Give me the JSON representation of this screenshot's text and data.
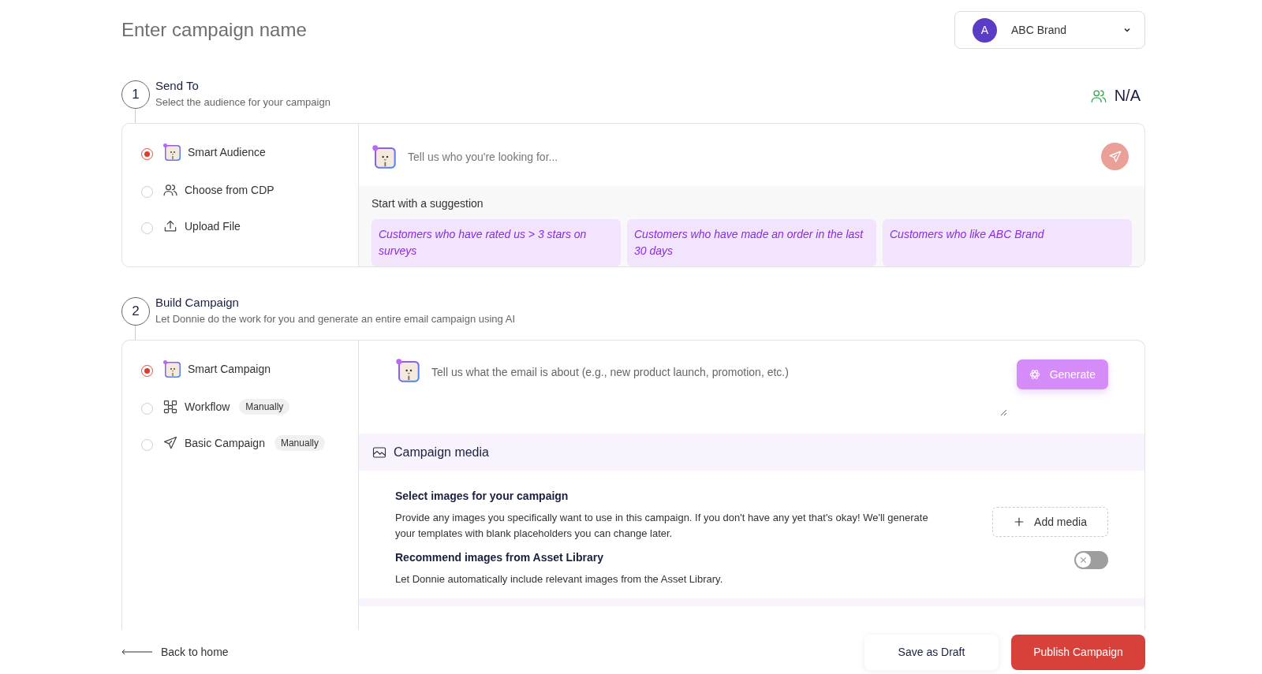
{
  "campaign_name": {
    "placeholder": "Enter campaign name"
  },
  "brand_select": {
    "avatar": "A",
    "label": "ABC Brand"
  },
  "send_to": {
    "number": "1",
    "title": "Send To",
    "subtitle": "Select the audience for your campaign",
    "audience_count": "N/A",
    "options": [
      {
        "label": "Smart Audience",
        "kind": "mascot",
        "selected": true
      },
      {
        "label": "Choose from CDP",
        "kind": "users",
        "selected": false
      },
      {
        "label": "Upload File",
        "kind": "upload",
        "selected": false
      }
    ],
    "prompt": {
      "placeholder": "Tell us who you're looking for..."
    },
    "suggestion_heading": "Start with a suggestion",
    "suggestions": [
      "Customers who have rated us > 3 stars on surveys",
      "Customers who have made an order in the last 30 days",
      "Customers who like ABC Brand"
    ]
  },
  "build_campaign": {
    "number": "2",
    "title": "Build Campaign",
    "subtitle": "Let Donnie do the work for you and generate an entire email campaign using AI",
    "options": [
      {
        "label": "Smart Campaign",
        "kind": "mascot",
        "selected": true
      },
      {
        "label": "Workflow",
        "kind": "workflow",
        "badge": "Manually",
        "selected": false
      },
      {
        "label": "Basic Campaign",
        "kind": "send",
        "badge": "Manually",
        "selected": false
      }
    ],
    "prompt": {
      "placeholder": "Tell us what the email is about (e.g., new product launch, promotion, etc.)"
    },
    "generate_button": "Generate",
    "media": {
      "heading": "Campaign media",
      "select_title": "Select images for your campaign",
      "select_text": "Provide any images you specifically want to use in this campaign. If you don't have any yet that's okay! We'll generate your templates with blank placeholders you can change later.",
      "add_button": "Add media",
      "recommend_title": "Recommend images from Asset Library",
      "recommend_text": "Let Donnie automatically include relevant images from the Asset Library.",
      "recommend_on": false
    }
  },
  "footer": {
    "back_link": "Back to home",
    "draft_button": "Save as Draft",
    "publish_button": "Publish Campaign"
  }
}
